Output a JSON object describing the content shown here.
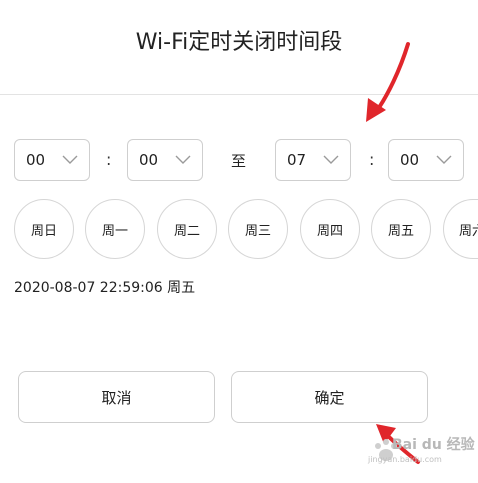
{
  "dialog": {
    "title": "Wi-Fi定时关闭时间段"
  },
  "time_range": {
    "start_hour": "00",
    "start_minute": "00",
    "separator": ":",
    "to_label": "至",
    "end_hour": "07",
    "end_minute": "00"
  },
  "weekdays": [
    "周日",
    "周一",
    "周二",
    "周三",
    "周四",
    "周五",
    "周六"
  ],
  "current_time": "2020-08-07 22:59:06 周五",
  "buttons": {
    "cancel": "取消",
    "confirm": "确定"
  },
  "watermark": {
    "brand": "Bai du 经验",
    "url": "jingyan.baidu.com"
  },
  "colors": {
    "annotation_arrow": "#e0262b",
    "border": "#cfcfcf"
  }
}
